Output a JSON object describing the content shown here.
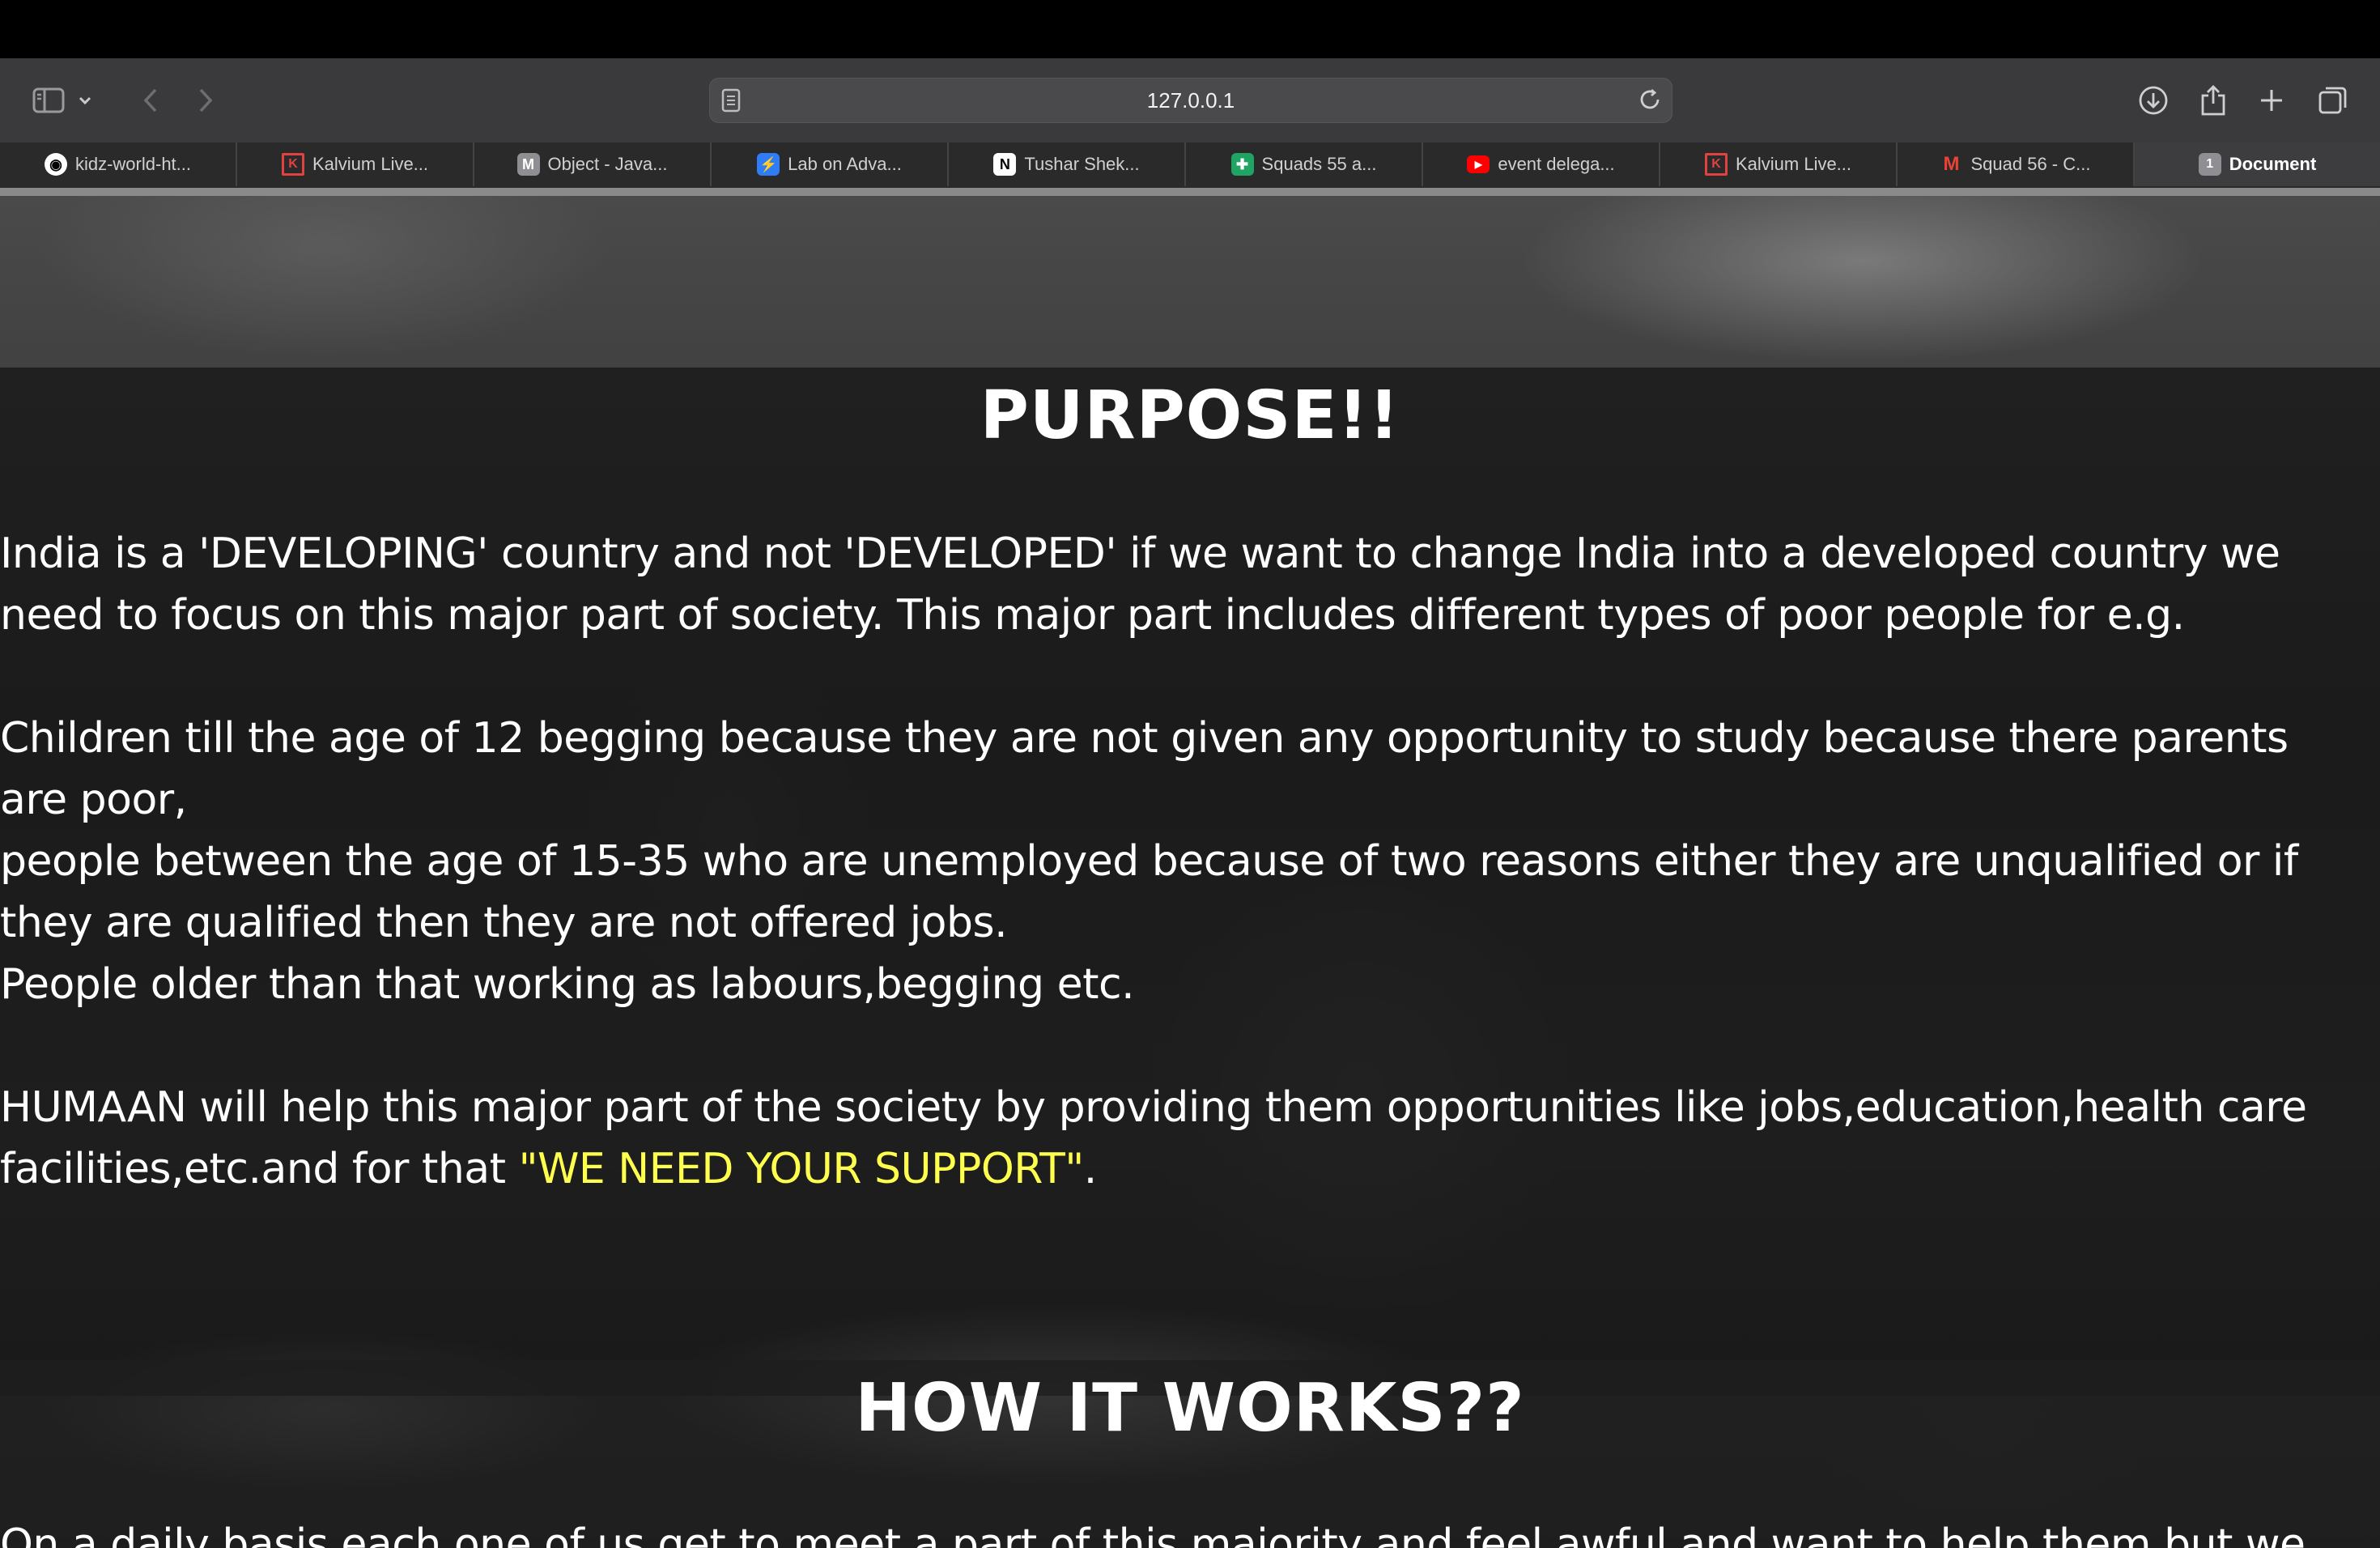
{
  "browser": {
    "url": "127.0.0.1",
    "tabs": [
      {
        "label": "kidz-world-ht...",
        "icon": "github-icon",
        "fav_color": "#ffffff"
      },
      {
        "label": "Kalvium Live...",
        "icon": "kalvium-icon",
        "fav_color": "#e0433f"
      },
      {
        "label": "Object - Java...",
        "icon": "m-icon",
        "fav_color": "#8e8e93"
      },
      {
        "label": "Lab on Adva...",
        "icon": "bolt-icon",
        "fav_color": "#2f7df6"
      },
      {
        "label": "Tushar Shek...",
        "icon": "notion-icon",
        "fav_color": "#ffffff"
      },
      {
        "label": "Squads 55 a...",
        "icon": "sheets-icon",
        "fav_color": "#1fa463"
      },
      {
        "label": "event delega...",
        "icon": "youtube-icon",
        "fav_color": "#ff0000"
      },
      {
        "label": "Kalvium Live...",
        "icon": "kalvium-icon",
        "fav_color": "#e0433f"
      },
      {
        "label": "Squad 56 - C...",
        "icon": "gmail-icon",
        "fav_color": "#ea4335"
      },
      {
        "label": "Document",
        "icon": "count-badge-icon",
        "badge": "1",
        "fav_color": "#8e8e93",
        "active": true
      }
    ]
  },
  "page": {
    "purpose": {
      "heading": "PURPOSE!!",
      "lines": [
        "India is a 'DEVELOPING' country and not 'DEVELOPED' if we want to change India into a developed country we",
        "need to focus on this major part of society. This major part includes different types of poor people for e.g.",
        "",
        "Children till the age of 12 begging because they are not given any opportunity to study because there parents",
        "are poor,",
        "people between the age of 15-35 who are unemployed because of two reasons either they are unqualified or if",
        "they are qualified then they are not offered jobs.",
        "People older than that working as labours,begging etc.",
        "",
        "HUMAAN will help this major part of the society by providing them opportunities like jobs,education,health care"
      ],
      "last_line_before": "facilities,etc.and for that ",
      "last_line_highlight": "\"WE NEED YOUR SUPPORT\"",
      "last_line_after": "."
    },
    "how": {
      "heading": "HOW IT WORKS??",
      "first_line": "On a daily basis each one of us get to meet a part of this majority and feel awful and want to help them but we"
    }
  },
  "colors": {
    "highlight": "#ffff4d",
    "band": "rgba(20,20,20,0.72)",
    "toolbar": "#3a3a3c"
  }
}
